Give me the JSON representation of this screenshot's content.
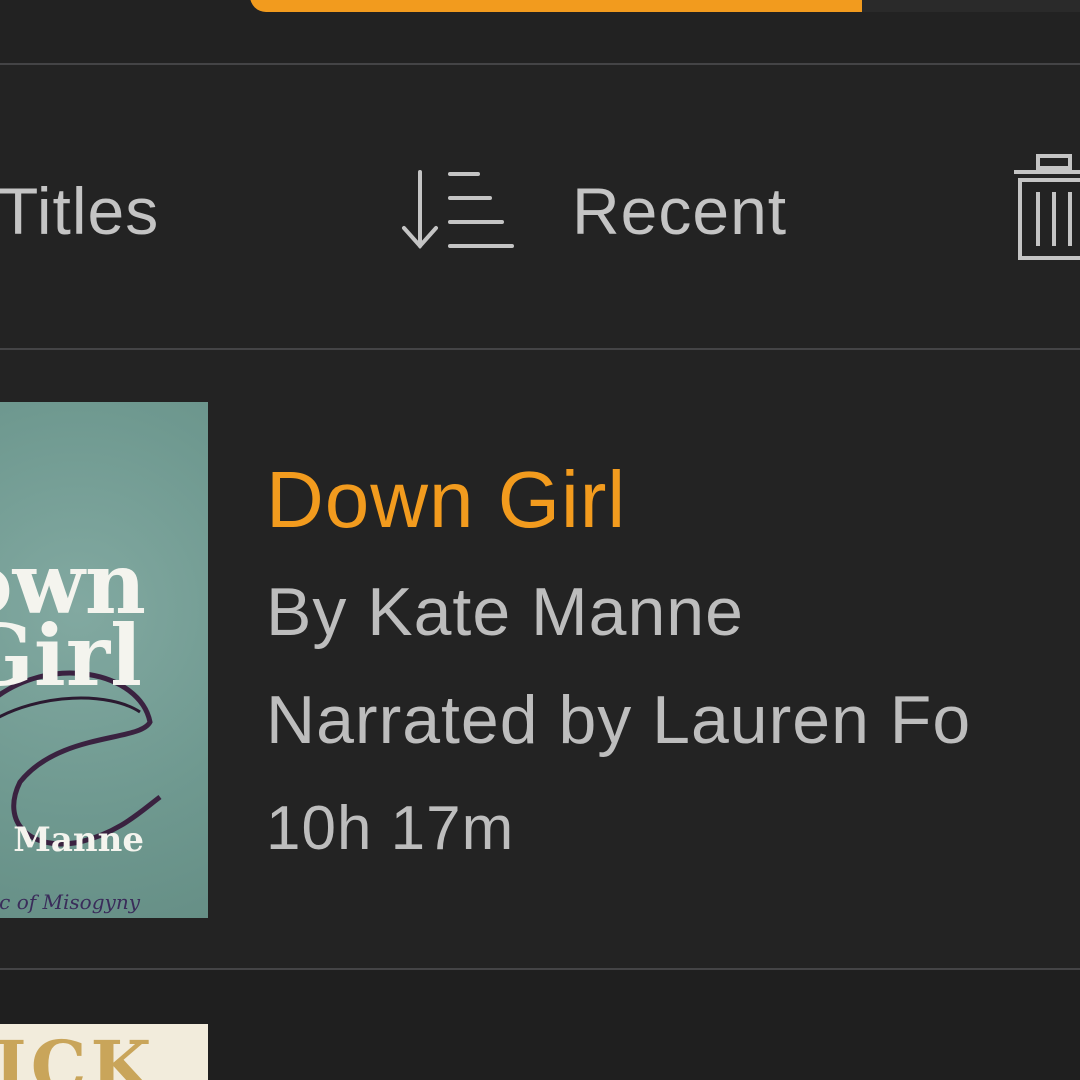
{
  "progress": {
    "fraction": 0.68,
    "accent_color": "#f29b1e"
  },
  "toolbar": {
    "filter_label": "Titles",
    "sort_label": "Recent",
    "sort_icon": "sort-descending-icon",
    "trash_icon": "trash-icon"
  },
  "book": {
    "title": "Down Girl",
    "author": "By Kate Manne",
    "narrator": "Narrated by Lauren Fo",
    "duration": "10h 17m",
    "cover": {
      "line1": "own",
      "line2": "Girl",
      "author": "Manne",
      "subtitle": "c of Misogyny"
    }
  },
  "next_book": {
    "cover_text": "ICK"
  }
}
